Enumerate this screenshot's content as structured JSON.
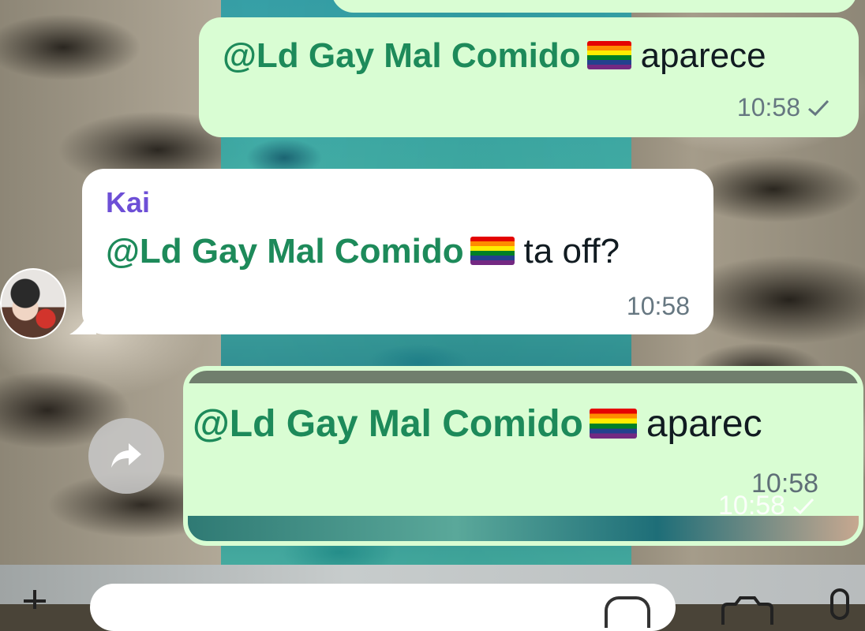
{
  "messages": [
    {
      "direction": "outgoing",
      "mention": "@Ld Gay Mal Comido",
      "emoji": "rainbow-flag",
      "text": "aparece",
      "time": "10:58",
      "status": "sent"
    },
    {
      "direction": "incoming",
      "sender": "Kai",
      "mention": "@Ld Gay Mal Comido",
      "emoji": "rainbow-flag",
      "text": "ta off?",
      "time": "10:58"
    },
    {
      "direction": "outgoing",
      "selected": true,
      "mention": "@Ld Gay Mal Comido",
      "emoji": "rainbow-flag",
      "text": "aparec",
      "time": "10:58",
      "time_overlay": "10:58",
      "status": "sent"
    }
  ],
  "icons": {
    "forward": "forward-arrow-icon",
    "attach": "plus-icon",
    "sticker": "sticker-icon",
    "camera": "camera-icon",
    "mic": "microphone-icon"
  },
  "colors": {
    "outgoing_bubble": "#d9fdd3",
    "incoming_bubble": "#ffffff",
    "mention": "#1d8a5a",
    "sender_name": "#6d4fd6",
    "timestamp": "#667781"
  }
}
